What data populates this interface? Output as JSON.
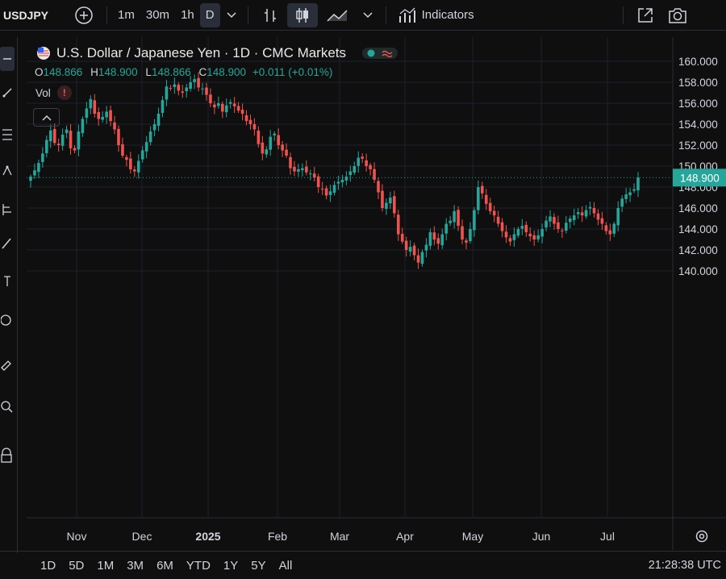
{
  "toolbar": {
    "symbol": "USDJPY",
    "intervals": [
      "1m",
      "30m",
      "1h",
      "D"
    ],
    "active_interval": "D",
    "indicators_label": "Indicators"
  },
  "legend": {
    "title": "U.S. Dollar / Japanese Yen · 1D · CMC Markets",
    "open_label": "O",
    "open": "148.866",
    "high_label": "H",
    "high": "148.900",
    "low_label": "L",
    "low": "148.866",
    "close_label": "C",
    "close": "148.900",
    "change": "+0.011 (+0.01%)",
    "vol_label": "Vol",
    "vol_warning": "!"
  },
  "price_axis": {
    "labels": [
      "160.000",
      "158.000",
      "156.000",
      "154.000",
      "152.000",
      "150.000",
      "148.000",
      "146.000",
      "144.000",
      "142.000",
      "140.000"
    ],
    "current_price": "148.900"
  },
  "time_axis": {
    "labels": [
      "Nov",
      "Dec",
      "2025",
      "Feb",
      "Mar",
      "Apr",
      "May",
      "Jun",
      "Jul"
    ]
  },
  "ranges": [
    "1D",
    "5D",
    "1M",
    "3M",
    "6M",
    "YTD",
    "1Y",
    "5Y",
    "All"
  ],
  "clock": "21:28:38 UTC",
  "colors": {
    "up": "#26a69a",
    "down": "#ef5350",
    "background": "#0f0f0f",
    "grid": "#1e222d"
  },
  "chart_data": {
    "type": "candlestick",
    "title": "U.S. Dollar / Japanese Yen · 1D · CMC Markets",
    "ylim": [
      139,
      161
    ],
    "x_ticks": [
      "Nov",
      "Dec",
      "2025",
      "Feb",
      "Mar",
      "Apr",
      "May",
      "Jun",
      "Jul"
    ],
    "closes": [
      149.0,
      149.6,
      150.3,
      151.2,
      152.5,
      153.4,
      152.2,
      152.0,
      153.0,
      153.5,
      151.7,
      151.5,
      153.3,
      154.5,
      155.5,
      156.4,
      155.0,
      154.5,
      154.7,
      155.2,
      154.3,
      153.5,
      152.0,
      151.0,
      150.6,
      149.7,
      149.5,
      150.5,
      151.5,
      152.3,
      153.3,
      154.0,
      155.0,
      156.3,
      157.6,
      157.4,
      157.8,
      157.2,
      157.0,
      157.5,
      158.0,
      158.3,
      157.5,
      157.4,
      156.8,
      156.0,
      155.6,
      156.0,
      155.2,
      155.8,
      156.1,
      155.7,
      155.3,
      155.0,
      154.3,
      154.0,
      153.5,
      152.1,
      151.2,
      151.6,
      152.8,
      153.1,
      152.0,
      151.5,
      151.0,
      149.8,
      149.5,
      149.7,
      149.8,
      149.4,
      149.3,
      148.9,
      148.0,
      147.8,
      147.2,
      147.6,
      148.2,
      148.5,
      148.7,
      149.0,
      149.5,
      150.0,
      150.8,
      150.7,
      150.0,
      149.7,
      148.7,
      147.5,
      146.0,
      146.5,
      147.0,
      145.5,
      143.5,
      142.8,
      142.0,
      142.3,
      141.5,
      140.8,
      141.8,
      142.5,
      143.7,
      143.0,
      142.6,
      143.5,
      144.5,
      144.8,
      145.7,
      144.3,
      143.0,
      142.7,
      144.0,
      145.8,
      148.0,
      147.4,
      146.4,
      145.7,
      145.3,
      144.5,
      143.8,
      143.2,
      142.8,
      143.5,
      144.0,
      144.3,
      143.7,
      143.3,
      143.0,
      143.4,
      144.0,
      144.8,
      145.2,
      144.5,
      144.0,
      143.8,
      144.6,
      145.0,
      145.3,
      145.6,
      145.3,
      145.8,
      146.1,
      145.5,
      144.9,
      144.5,
      143.8,
      143.5,
      144.5,
      146.0,
      146.9,
      147.3,
      147.5,
      147.8,
      148.9
    ]
  }
}
